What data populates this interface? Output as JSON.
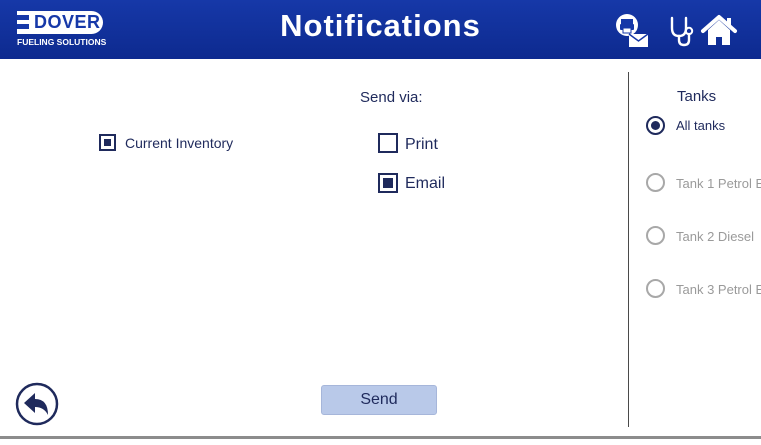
{
  "header": {
    "logo_word": "DOVER",
    "logo_subtitle": "FUELING SOLUTIONS",
    "title": "Notifications",
    "icons": [
      "print-email-icon",
      "stethoscope-icon",
      "home-icon"
    ],
    "background_color": "#1638a8"
  },
  "reports": {
    "current_inventory": {
      "label": "Current Inventory",
      "checked": true
    }
  },
  "send_via": {
    "heading": "Send via:",
    "print": {
      "label": "Print",
      "checked": false
    },
    "email": {
      "label": "Email",
      "checked": true
    }
  },
  "tanks": {
    "heading": "Tanks",
    "options": [
      {
        "label": "All tanks",
        "selected": true,
        "enabled": true
      },
      {
        "label": "Tank 1 Petrol E",
        "selected": false,
        "enabled": false
      },
      {
        "label": "Tank 2 Diesel",
        "selected": false,
        "enabled": false
      },
      {
        "label": "Tank 3 Petrol E",
        "selected": false,
        "enabled": false
      }
    ]
  },
  "actions": {
    "send_label": "Send",
    "back_icon": "back-arrow-icon"
  },
  "colors": {
    "accent": "#1f2a5c",
    "button": "#b9c9e9",
    "disabled": "#9a9a9a"
  }
}
